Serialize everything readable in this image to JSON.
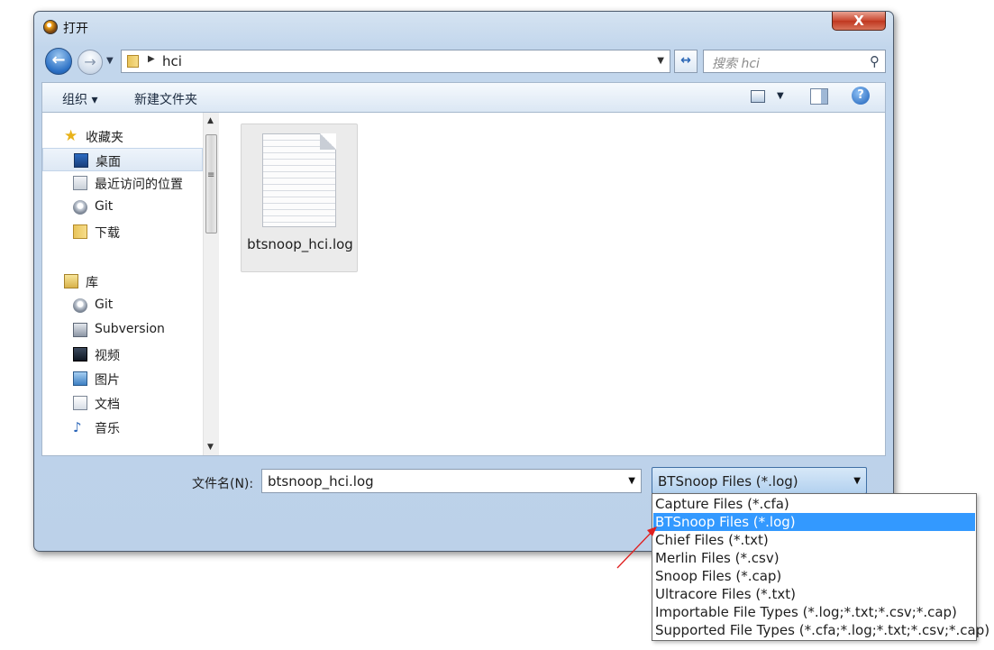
{
  "window": {
    "title": "打开",
    "close_label": "X"
  },
  "nav": {
    "back_glyph": "←",
    "forward_glyph": "→",
    "dropdown_glyph": "▼",
    "refresh_glyph": "↔",
    "breadcrumb_separator": "▶",
    "breadcrumb": "hci",
    "search_placeholder": "搜索 hci",
    "search_glyph": "⚲"
  },
  "toolbar": {
    "organize_label": "组织 ▾",
    "new_folder_label": "新建文件夹",
    "help_glyph": "?",
    "view_drop_glyph": "▼"
  },
  "sidebar": {
    "items": [
      {
        "label": "收藏夹",
        "icon": "star-icon",
        "level": "top"
      },
      {
        "label": "桌面",
        "icon": "desktop-icon",
        "level": "sub",
        "selected": true
      },
      {
        "label": "最近访问的位置",
        "icon": "recent-places-icon",
        "level": "sub"
      },
      {
        "label": "Git",
        "icon": "git-icon",
        "level": "sub"
      },
      {
        "label": "下载",
        "icon": "downloads-icon",
        "level": "sub"
      },
      {
        "label": "库",
        "icon": "library-icon",
        "level": "top"
      },
      {
        "label": "Git",
        "icon": "git-icon",
        "level": "sub"
      },
      {
        "label": "Subversion",
        "icon": "subversion-icon",
        "level": "sub"
      },
      {
        "label": "视频",
        "icon": "video-icon",
        "level": "sub"
      },
      {
        "label": "图片",
        "icon": "pictures-icon",
        "level": "sub"
      },
      {
        "label": "文档",
        "icon": "documents-icon",
        "level": "sub"
      },
      {
        "label": "音乐",
        "icon": "music-icon",
        "level": "sub"
      }
    ],
    "scroll_up_glyph": "▲",
    "scroll_down_glyph": "▼",
    "scroll_grip_glyph": "≡"
  },
  "files": [
    {
      "name": "btsnoop_hci.log",
      "icon": "text-document-icon"
    }
  ],
  "footer": {
    "filename_label": "文件名(N):",
    "filename_value": "btsnoop_hci.log",
    "filetype_selected": "BTSnoop Files (*.log)",
    "dropdown_glyph": "▼"
  },
  "filetype_options": [
    "Capture Files (*.cfa)",
    "BTSnoop Files (*.log)",
    "Chief Files (*.txt)",
    "Merlin Files (*.csv)",
    "Snoop Files (*.cap)",
    "Ultracore Files (*.txt)",
    "Importable File Types (*.log;*.txt;*.csv;*.cap)",
    "Supported File Types (*.cfa;*.log;*.txt;*.csv;*.cap)"
  ],
  "selected_option_index": 1,
  "colors": {
    "selection": "#3399ff",
    "annotation_arrow": "#e02020"
  }
}
